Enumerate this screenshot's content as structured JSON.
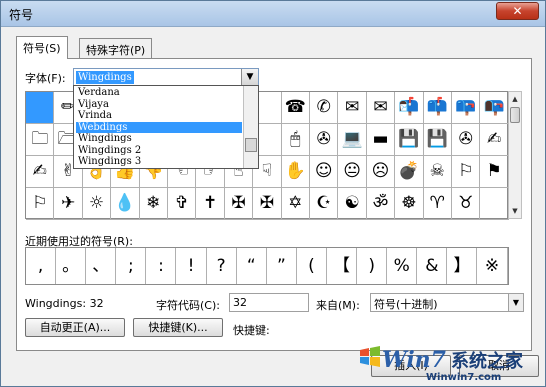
{
  "window": {
    "title": "符号",
    "close_glyph": "✕"
  },
  "tabs": [
    {
      "label": "符号(S)"
    },
    {
      "label": "特殊字符(P)"
    }
  ],
  "font_label": "字体(F):",
  "font_value": "Wingdings",
  "font_dropdown": {
    "options": [
      "Verdana",
      "Vijaya",
      "Vrinda",
      "Webdings",
      "Wingdings",
      "Wingdings 2",
      "Wingdings 3"
    ],
    "highlighted": "Webdings"
  },
  "symbol_grid": {
    "rows": [
      [
        "",
        "✏",
        "",
        "",
        "",
        "",
        "",
        "",
        "",
        "☎",
        "✆",
        "✉",
        "✉",
        "📬",
        "📫",
        "📪",
        "📭"
      ],
      [
        "🗀",
        "🗁",
        "",
        "",
        "",
        "",
        "",
        "",
        "",
        "🖱",
        "✇",
        "💻",
        "▬",
        "💾",
        "💾",
        "✇",
        "✍"
      ],
      [
        "✍",
        "✌",
        "👌",
        "👍",
        "👎",
        "☜",
        "☞",
        "☝",
        "☟",
        "✋",
        "☺",
        "😐",
        "☹",
        "💣",
        "☠",
        "⚐",
        "⚑"
      ],
      [
        "⚐",
        "✈",
        "☼",
        "💧",
        "❄",
        "✞",
        "✝",
        "✠",
        "✠",
        "✡",
        "☪",
        "☯",
        "ॐ",
        "☸",
        "♈",
        "♉",
        ""
      ]
    ]
  },
  "recent_label": "近期使用过的符号(R):",
  "recent_symbols": [
    ",",
    "。",
    "、",
    ";",
    ":",
    "!",
    "?",
    "“",
    "”",
    "(",
    "【",
    ")",
    "%",
    "&",
    "】",
    "※"
  ],
  "char_name": "Wingdings: 32",
  "char_code_label": "字符代码(C):",
  "char_code_value": "32",
  "from_label": "来自(M):",
  "from_value": "符号(十进制)",
  "autocorrect_button": "自动更正(A)...",
  "shortcut_button": "快捷键(K)...",
  "shortcut_label": "快捷键:",
  "insert_button": "插入(I)",
  "cancel_button": "取消",
  "watermark": {
    "brand": "Win7",
    "cn": "系统之家",
    "url": "Winwin7.com"
  }
}
